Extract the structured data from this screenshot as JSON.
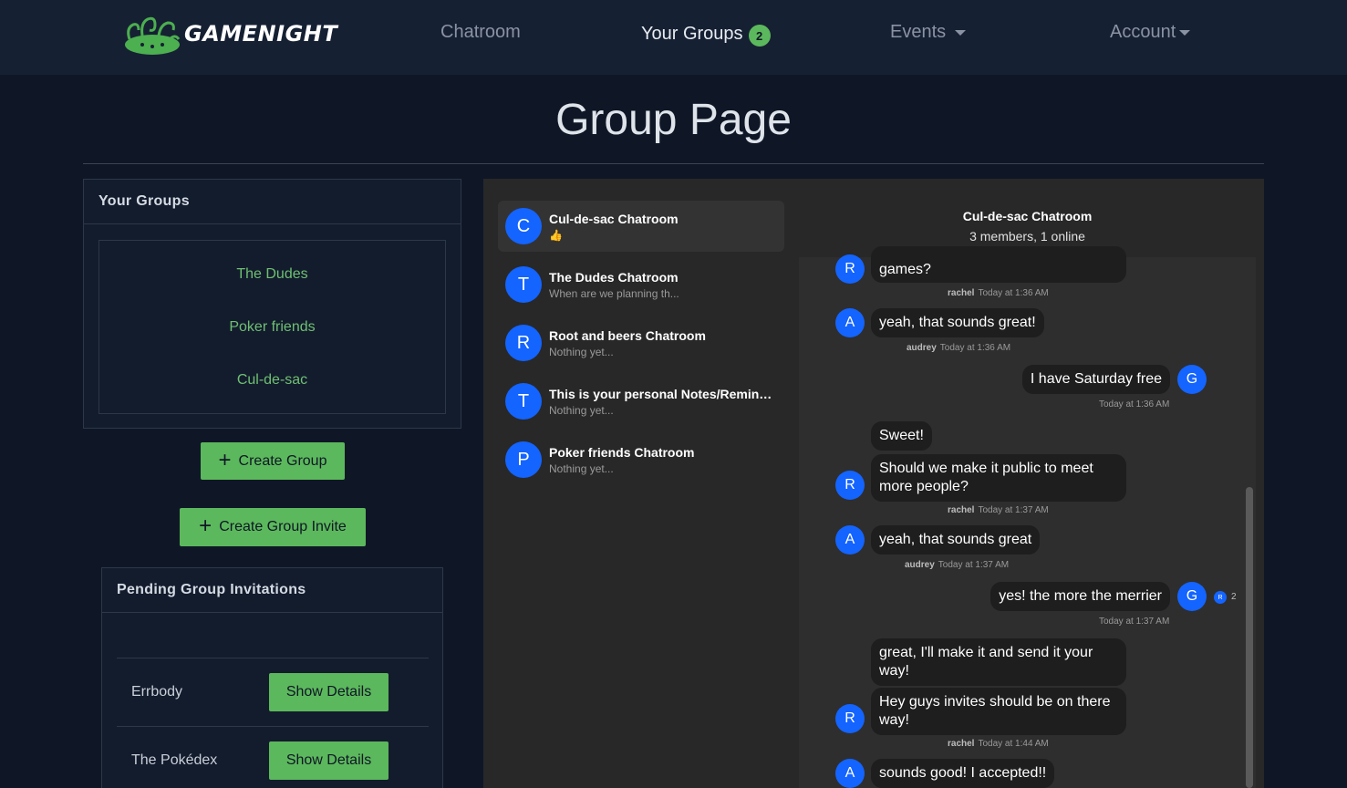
{
  "nav": {
    "brand": "GAMENIGHT",
    "chatroom": "Chatroom",
    "groups": "Your Groups",
    "groups_badge": "2",
    "events": "Events",
    "account": "Account"
  },
  "page": {
    "title": "Group Page"
  },
  "your_groups": {
    "header": "Your Groups",
    "items": [
      "The Dudes",
      "Poker friends",
      "Cul-de-sac"
    ]
  },
  "buttons": {
    "create_group": "Create Group",
    "create_invite": "Create Group Invite"
  },
  "pending": {
    "header": "Pending Group Invitations",
    "invites": [
      {
        "name": "Errbody",
        "button": "Show Details"
      },
      {
        "name": "The Pokédex",
        "button": "Show Details"
      }
    ]
  },
  "conversations": [
    {
      "initial": "C",
      "title": "Cul-de-sac Chatroom",
      "sub": "👍"
    },
    {
      "initial": "T",
      "title": "The Dudes Chatroom",
      "sub": "When are we planning th..."
    },
    {
      "initial": "R",
      "title": "Root and beers Chatroom",
      "sub": "Nothing yet..."
    },
    {
      "initial": "T",
      "title": "This is your personal Notes/Reminders",
      "sub": "Nothing yet..."
    },
    {
      "initial": "P",
      "title": "Poker friends Chatroom",
      "sub": "Nothing yet..."
    }
  ],
  "chat": {
    "title": "Cul-de-sac Chatroom",
    "status": "3 members, 1 online",
    "messages": [
      {
        "text": "games?",
        "meta_user": "rachel",
        "meta_time": "Today at 1:36 AM"
      },
      {
        "text": "yeah, that sounds great!",
        "meta_user": "audrey",
        "meta_time": "Today at 1:36 AM"
      },
      {
        "text": "I have Saturday free",
        "meta_time": "Today at 1:36 AM"
      },
      {
        "text": "Sweet!"
      },
      {
        "text": "Should we make it public to meet more people?",
        "meta_user": "rachel",
        "meta_time": "Today at 1:37 AM"
      },
      {
        "text": "yeah, that sounds great",
        "meta_user": "audrey",
        "meta_time": "Today at 1:37 AM"
      },
      {
        "text": "yes! the more the merrier",
        "meta_time": "Today at 1:37 AM",
        "read_count": "2"
      },
      {
        "text": "great, I'll make it and send it your way!"
      },
      {
        "text": "Hey guys invites should be on there way!",
        "meta_user": "rachel",
        "meta_time": "Today at 1:44 AM"
      },
      {
        "text": "sounds good! I accepted!!"
      }
    ],
    "avatars": {
      "rachel": "R",
      "audrey": "A",
      "me": "G"
    }
  }
}
